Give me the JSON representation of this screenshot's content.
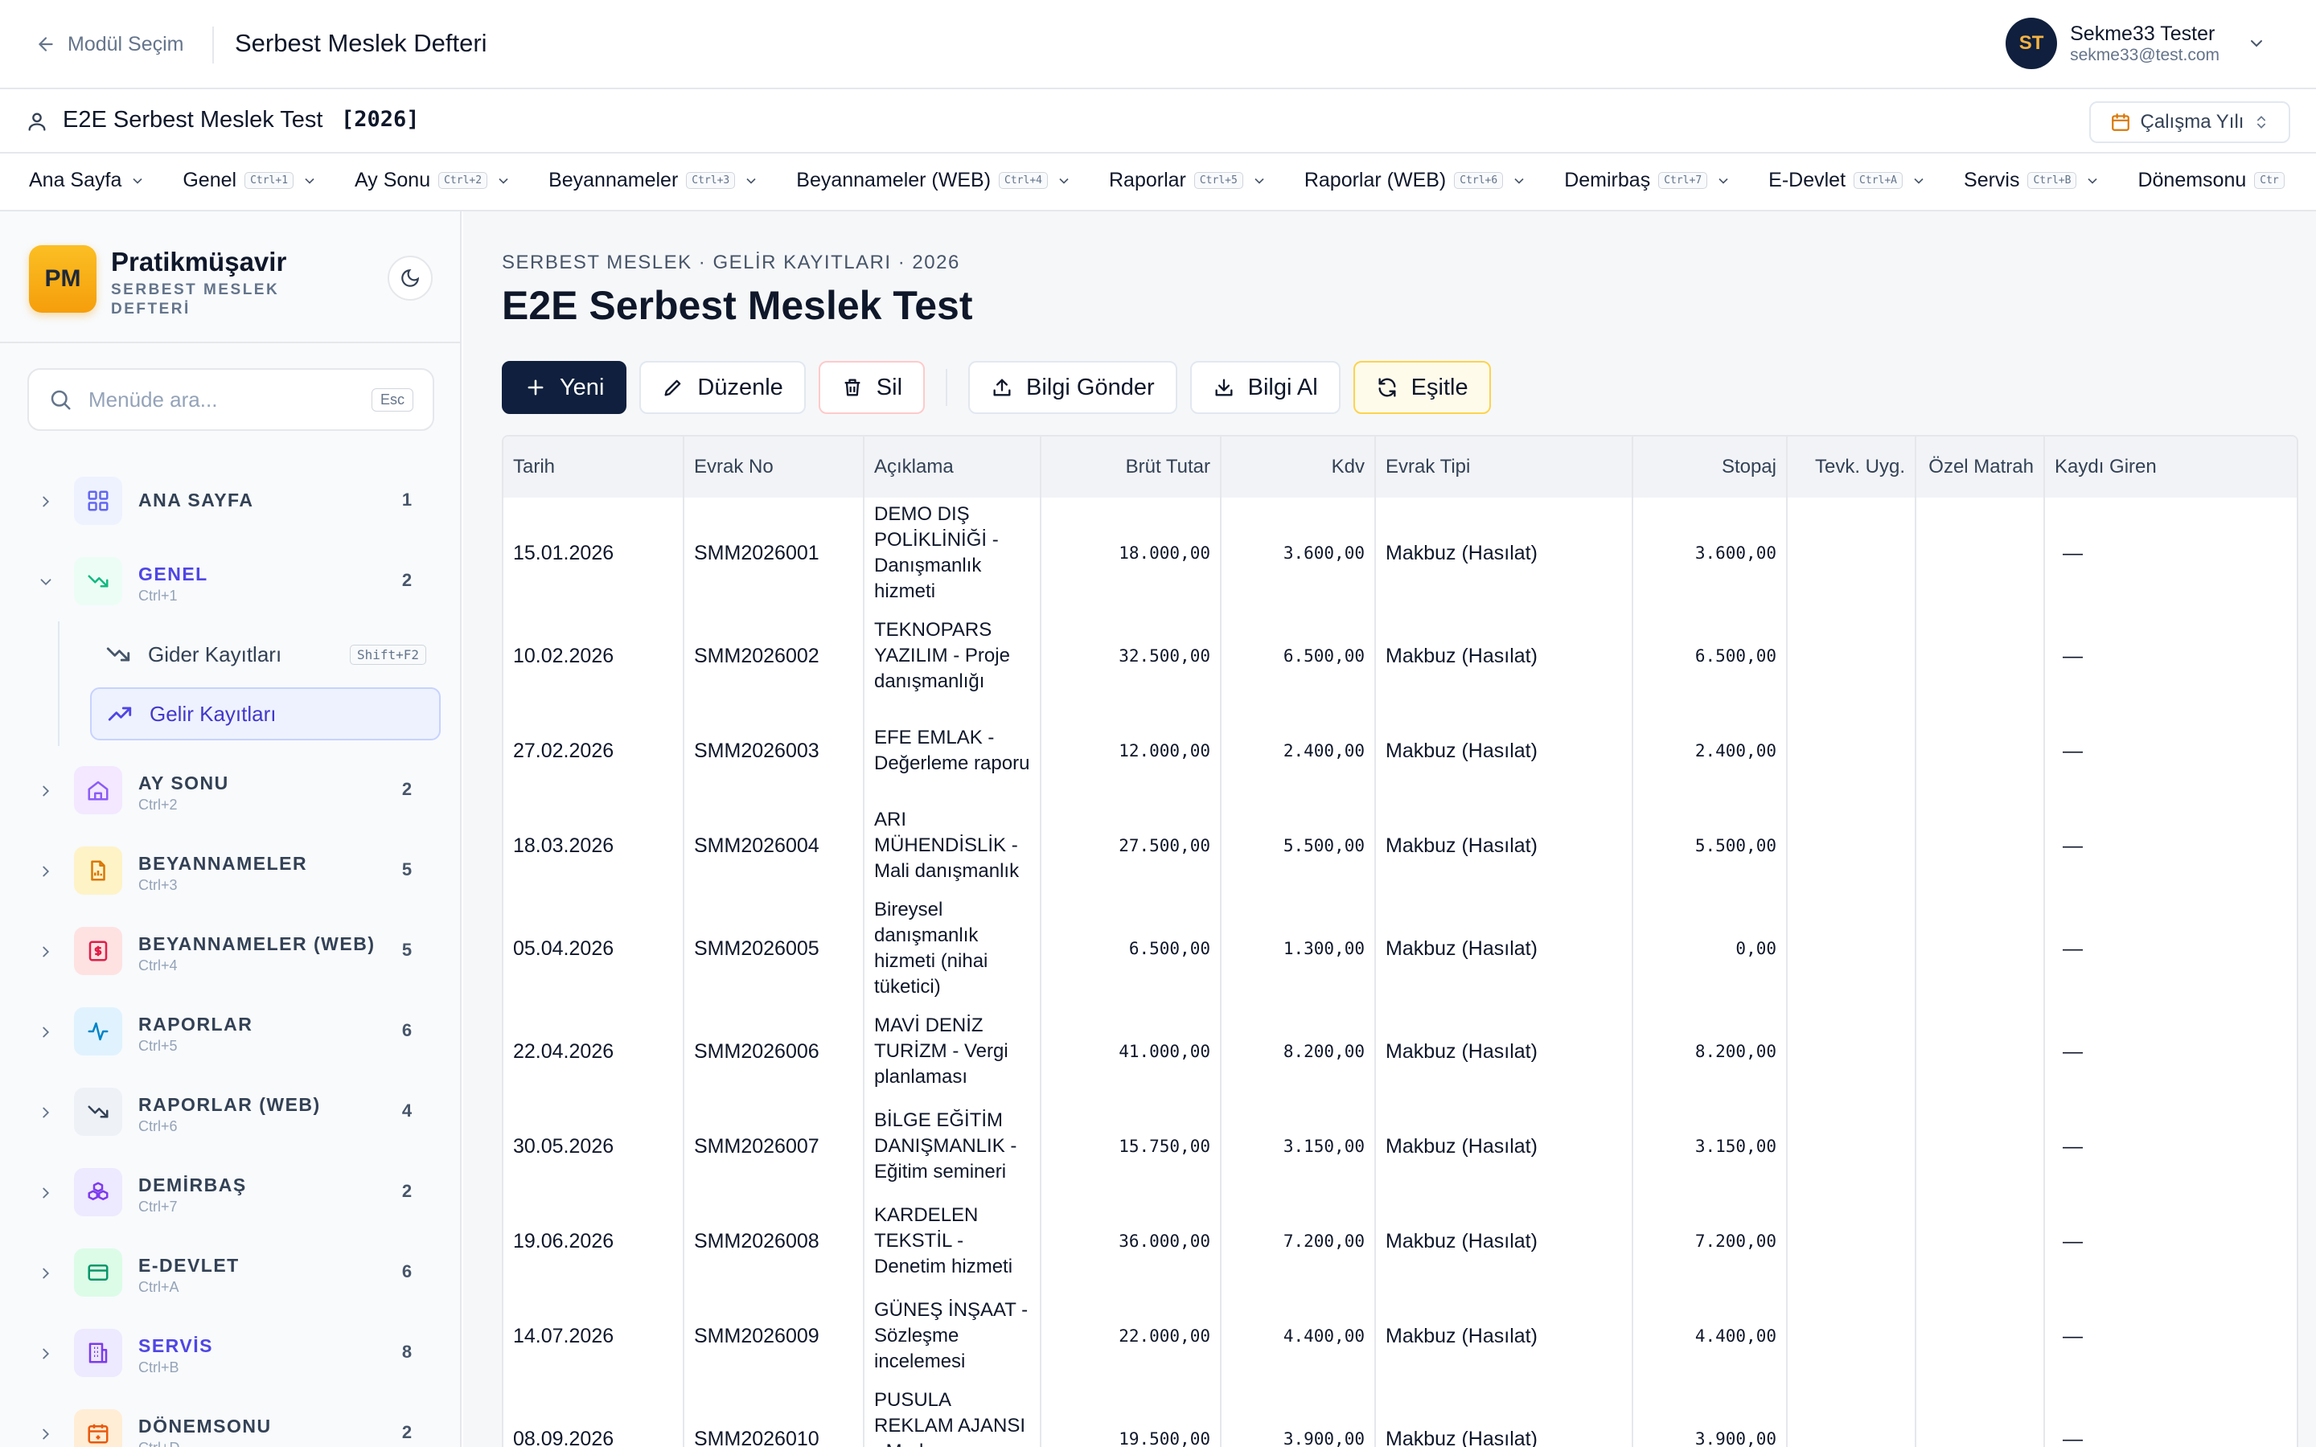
{
  "topbar": {
    "back_label": "Modül Seçim",
    "app_title": "Serbest Meslek Defteri",
    "user": {
      "initials": "ST",
      "name": "Sekme33 Tester",
      "email": "sekme33@test.com"
    }
  },
  "company": {
    "name": "E2E Serbest Meslek Test",
    "year": "[2026]",
    "year_button": "Çalışma Yılı"
  },
  "menu": [
    {
      "label": "Ana Sayfa",
      "shortcut": ""
    },
    {
      "label": "Genel",
      "shortcut": "Ctrl+1"
    },
    {
      "label": "Ay Sonu",
      "shortcut": "Ctrl+2"
    },
    {
      "label": "Beyannameler",
      "shortcut": "Ctrl+3"
    },
    {
      "label": "Beyannameler (WEB)",
      "shortcut": "Ctrl+4"
    },
    {
      "label": "Raporlar",
      "shortcut": "Ctrl+5"
    },
    {
      "label": "Raporlar (WEB)",
      "shortcut": "Ctrl+6"
    },
    {
      "label": "Demirbaş",
      "shortcut": "Ctrl+7"
    },
    {
      "label": "E-Devlet",
      "shortcut": "Ctrl+A"
    },
    {
      "label": "Servis",
      "shortcut": "Ctrl+B"
    },
    {
      "label": "Dönemsonu",
      "shortcut": "Ctr"
    }
  ],
  "sidebar": {
    "brand_logo": "PM",
    "brand_name": "Pratikmüşavir",
    "brand_sub": "SERBEST MESLEK DEFTERİ",
    "search_placeholder": "Menüde ara...",
    "search_key": "Esc",
    "items": [
      {
        "title": "ANA SAYFA",
        "shortcut": "",
        "count": "1",
        "icon": "grid-icon"
      },
      {
        "title": "GENEL",
        "shortcut": "Ctrl+1",
        "count": "2",
        "icon": "trend-down-icon"
      },
      {
        "title": "AY SONU",
        "shortcut": "Ctrl+2",
        "count": "2",
        "icon": "home-icon"
      },
      {
        "title": "BEYANNAMELER",
        "shortcut": "Ctrl+3",
        "count": "5",
        "icon": "file-chart-icon"
      },
      {
        "title": "BEYANNAMELER (WEB)",
        "shortcut": "Ctrl+4",
        "count": "5",
        "icon": "dollar-file-icon"
      },
      {
        "title": "RAPORLAR",
        "shortcut": "Ctrl+5",
        "count": "6",
        "icon": "activity-icon"
      },
      {
        "title": "RAPORLAR (WEB)",
        "shortcut": "Ctrl+6",
        "count": "4",
        "icon": "trend-down-icon"
      },
      {
        "title": "DEMİRBAŞ",
        "shortcut": "Ctrl+7",
        "count": "2",
        "icon": "boxes-icon"
      },
      {
        "title": "E-DEVLET",
        "shortcut": "Ctrl+A",
        "count": "6",
        "icon": "credit-card-icon"
      },
      {
        "title": "SERVİS",
        "shortcut": "Ctrl+B",
        "count": "8",
        "icon": "building-icon"
      },
      {
        "title": "DÖNEMSONU",
        "shortcut": "Ctrl+D",
        "count": "2",
        "icon": "calendar-icon"
      }
    ],
    "subitems": [
      {
        "label": "Gider Kayıtları",
        "shortcut": "Shift+F2"
      },
      {
        "label": "Gelir Kayıtları",
        "shortcut": ""
      }
    ]
  },
  "main": {
    "breadcrumb": "SERBEST MESLEK · GELİR KAYITLARI · 2026",
    "title": "E2E Serbest Meslek Test",
    "toolbar": {
      "new": "Yeni",
      "edit": "Düzenle",
      "delete": "Sil",
      "send": "Bilgi Gönder",
      "receive": "Bilgi Al",
      "sync": "Eşitle"
    },
    "columns": [
      "Tarih",
      "Evrak No",
      "Açıklama",
      "Brüt Tutar",
      "Kdv",
      "Evrak Tipi",
      "Stopaj",
      "Tevk. Uyg.",
      "Özel Matrah",
      "Kaydı Giren"
    ],
    "rows": [
      {
        "date": "15.01.2026",
        "no": "SMM2026001",
        "desc": "DEMO DIŞ POLİKLİNİĞİ - Danışmanlık hizmeti",
        "gross": "18.000,00",
        "kdv": "3.600,00",
        "type": "Makbuz (Hasılat)",
        "stopaj": "3.600,00",
        "tevk": "",
        "ozel": "",
        "giren": "—"
      },
      {
        "date": "10.02.2026",
        "no": "SMM2026002",
        "desc": "TEKNOPARS YAZILIM - Proje danışmanlığı",
        "gross": "32.500,00",
        "kdv": "6.500,00",
        "type": "Makbuz (Hasılat)",
        "stopaj": "6.500,00",
        "tevk": "",
        "ozel": "",
        "giren": "—"
      },
      {
        "date": "27.02.2026",
        "no": "SMM2026003",
        "desc": "EFE EMLAK - Değerleme raporu",
        "gross": "12.000,00",
        "kdv": "2.400,00",
        "type": "Makbuz (Hasılat)",
        "stopaj": "2.400,00",
        "tevk": "",
        "ozel": "",
        "giren": "—"
      },
      {
        "date": "18.03.2026",
        "no": "SMM2026004",
        "desc": "ARI MÜHENDİSLİK - Mali danışmanlık",
        "gross": "27.500,00",
        "kdv": "5.500,00",
        "type": "Makbuz (Hasılat)",
        "stopaj": "5.500,00",
        "tevk": "",
        "ozel": "",
        "giren": "—"
      },
      {
        "date": "05.04.2026",
        "no": "SMM2026005",
        "desc": "Bireysel danışmanlık hizmeti (nihai tüketici)",
        "gross": "6.500,00",
        "kdv": "1.300,00",
        "type": "Makbuz (Hasılat)",
        "stopaj": "0,00",
        "tevk": "",
        "ozel": "",
        "giren": "—"
      },
      {
        "date": "22.04.2026",
        "no": "SMM2026006",
        "desc": "MAVİ DENİZ TURİZM - Vergi planlaması",
        "gross": "41.000,00",
        "kdv": "8.200,00",
        "type": "Makbuz (Hasılat)",
        "stopaj": "8.200,00",
        "tevk": "",
        "ozel": "",
        "giren": "—"
      },
      {
        "date": "30.05.2026",
        "no": "SMM2026007",
        "desc": "BİLGE EĞİTİM DANIŞMANLIK - Eğitim semineri",
        "gross": "15.750,00",
        "kdv": "3.150,00",
        "type": "Makbuz (Hasılat)",
        "stopaj": "3.150,00",
        "tevk": "",
        "ozel": "",
        "giren": "—"
      },
      {
        "date": "19.06.2026",
        "no": "SMM2026008",
        "desc": "KARDELEN TEKSTİL - Denetim hizmeti",
        "gross": "36.000,00",
        "kdv": "7.200,00",
        "type": "Makbuz (Hasılat)",
        "stopaj": "7.200,00",
        "tevk": "",
        "ozel": "",
        "giren": "—"
      },
      {
        "date": "14.07.2026",
        "no": "SMM2026009",
        "desc": "GÜNEŞ İNŞAAT - Sözleşme incelemesi",
        "gross": "22.000,00",
        "kdv": "4.400,00",
        "type": "Makbuz (Hasılat)",
        "stopaj": "4.400,00",
        "tevk": "",
        "ozel": "",
        "giren": "—"
      },
      {
        "date": "08.09.2026",
        "no": "SMM2026010",
        "desc": "PUSULA REKLAM AJANSI - Marka danışmanlığı",
        "gross": "19.500,00",
        "kdv": "3.900,00",
        "type": "Makbuz (Hasılat)",
        "stopaj": "3.900,00",
        "tevk": "",
        "ozel": "",
        "giren": "—"
      }
    ]
  },
  "colors": {
    "accent": "#4f46e5",
    "primary_button": "#0f1f3d",
    "brand": "#f59e0b"
  }
}
